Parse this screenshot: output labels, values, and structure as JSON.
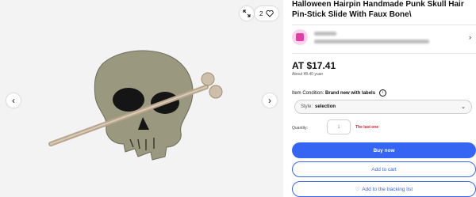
{
  "gallery": {
    "favorite_count": "2",
    "prev_icon": "chevron-left-icon",
    "next_icon": "chevron-right-icon",
    "expand_icon": "expand-icon",
    "favorite_icon": "heart-outline-icon"
  },
  "listing": {
    "title": "Halloween Hairpin Handmade Punk Skull Hair Pin-Stick Slide With Faux Bone\\",
    "price": "AT $17.41",
    "approx_price": "About ¥8.40 yuan",
    "condition_label": "Item Condition:",
    "condition_value": "Brand new with labels"
  },
  "variation": {
    "label": "Style:",
    "value": "selection"
  },
  "quantity": {
    "label": "Quantity:",
    "value": "1",
    "availability": "The last one"
  },
  "actions": {
    "buy_now": "Buy now",
    "add_to_cart": "Add to cart",
    "watch": "Add to the tracking list"
  },
  "colors": {
    "primary": "#3665f3",
    "alert": "#dd1e31",
    "seller_avatar": "#e23fa6"
  }
}
